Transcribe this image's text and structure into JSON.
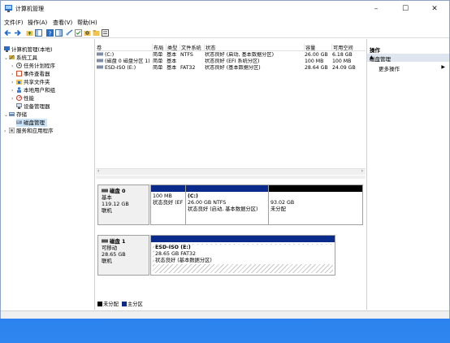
{
  "window": {
    "title": "计算机管理",
    "min": "–",
    "max": "☐",
    "close": "✕"
  },
  "menu": [
    "文件(F)",
    "操作(A)",
    "查看(V)",
    "帮助(H)"
  ],
  "tree": {
    "root": "计算机管理(本地)",
    "system_tools": "系统工具",
    "task_scheduler": "任务计划程序",
    "event_viewer": "事件查看器",
    "shared_folders": "共享文件夹",
    "local_users": "本地用户和组",
    "performance": "性能",
    "device_manager": "设备管理器",
    "storage": "存储",
    "disk_management": "磁盘管理",
    "services_apps": "服务和应用程序"
  },
  "volume_table": {
    "headers": [
      "卷",
      "布局",
      "类型",
      "文件系统",
      "状态",
      "容量",
      "可用空间"
    ],
    "rows": [
      [
        "(C:)",
        "简单",
        "基本",
        "NTFS",
        "状态良好 (启动, 基本数据分区)",
        "26.00 GB",
        "6.18 GB"
      ],
      [
        "(磁盘 0 磁盘分区 1)",
        "简单",
        "基本",
        "",
        "状态良好 (EFI 系统分区)",
        "100 MB",
        "100 MB"
      ],
      [
        "ESD-ISO (E:)",
        "简单",
        "基本",
        "FAT32",
        "状态良好 (基本数据分区)",
        "28.64 GB",
        "24.09 GB"
      ]
    ]
  },
  "disks": [
    {
      "name": "磁盘 0",
      "type": "基本",
      "size": "119.12 GB",
      "status": "联机",
      "partitions": [
        {
          "title": "",
          "line1": "100 MB",
          "line2": "状态良好 (EF",
          "bar": "#0a2a8c"
        },
        {
          "title": "(C:)",
          "line1": "26.00 GB NTFS",
          "line2": "状态良好 (启动, 基本数据分区)",
          "bar": "#0a2a8c"
        },
        {
          "title": "",
          "line1": "93.02 GB",
          "line2": "未分配",
          "bar": "#000000"
        }
      ]
    },
    {
      "name": "磁盘 1",
      "type": "可移动",
      "size": "28.65 GB",
      "status": "联机",
      "partitions": [
        {
          "title": "ESD-ISO  (E:)",
          "line1": "28.65 GB FAT32",
          "line2": "状态良好 (基本数据分区)",
          "bar": "#0a2a8c"
        }
      ]
    }
  ],
  "legend": {
    "unallocated": "未分配",
    "primary": "主分区",
    "unallocated_color": "#000000",
    "primary_color": "#0a2a8c"
  },
  "actions": {
    "header": "操作",
    "section": "磁盘管理",
    "more": "更多操作"
  },
  "icons": [
    "back-icon",
    "forward-icon",
    "up-icon",
    "properties-icon",
    "help-icon",
    "disk-icon",
    "folder-icon"
  ]
}
